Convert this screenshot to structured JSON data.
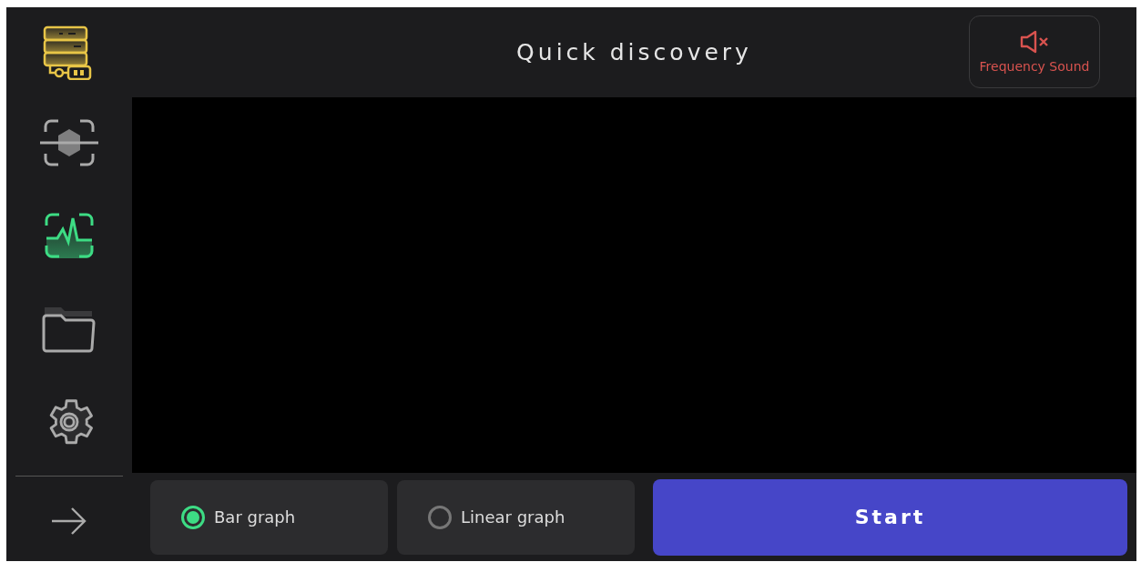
{
  "header": {
    "title": "Quick discovery",
    "sound_button": {
      "label": "Frequency Sound",
      "muted": true
    }
  },
  "sidebar": {
    "items": [
      {
        "kind": "scan",
        "selected": false
      },
      {
        "kind": "pulse",
        "selected": true
      },
      {
        "kind": "folder",
        "selected": false
      },
      {
        "kind": "settings",
        "selected": false
      }
    ]
  },
  "graph_modes": [
    {
      "label": "Bar graph",
      "selected": true
    },
    {
      "label": "Linear graph",
      "selected": false
    }
  ],
  "start_button": {
    "label": "Start"
  }
}
